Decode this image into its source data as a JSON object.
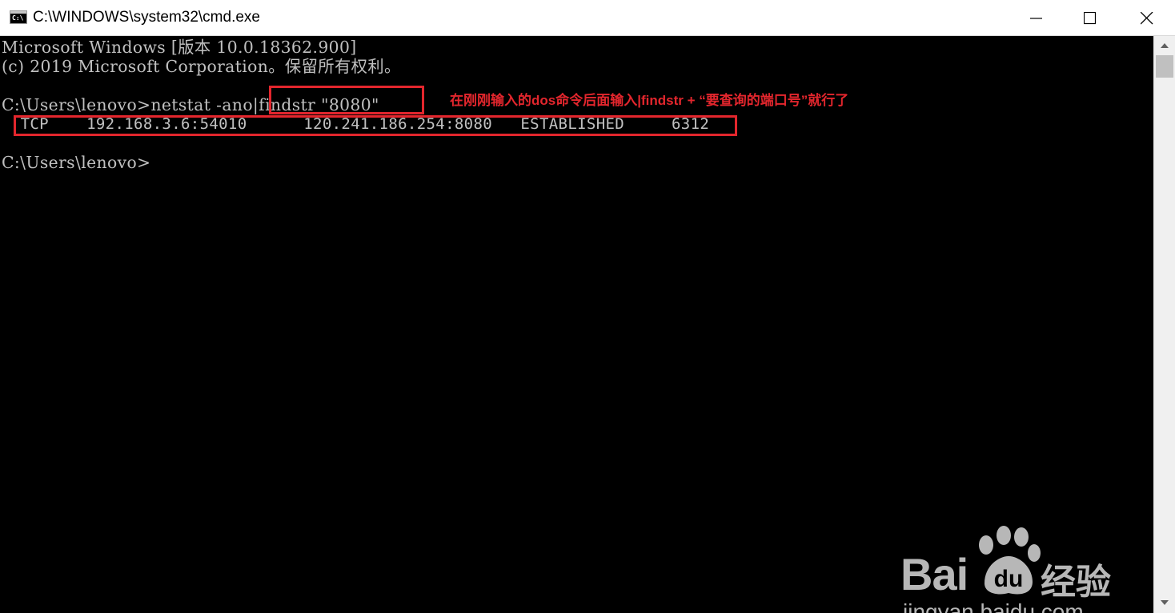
{
  "window": {
    "title": "C:\\WINDOWS\\system32\\cmd.exe",
    "icon_text": "C:\\",
    "controls": [
      "minimize-icon",
      "maximize-icon",
      "close-icon"
    ]
  },
  "console": {
    "lines": [
      "Microsoft Windows [版本 10.0.18362.900]",
      "(c) 2019 Microsoft Corporation。保留所有权利。",
      "C:\\Users\\lenovo>netstat -ano|findstr \"8080\"",
      "  TCP    192.168.3.6:54010      120.241.186.254:8080   ESTABLISHED     6312",
      "C:\\Users\\lenovo>"
    ],
    "text_color": "#c0c0c0",
    "background": "#000000"
  },
  "annotation": {
    "text": "在刚刚输入的dos命令后面输入|findstr + “要查询的端口号”就行了",
    "color": "#e3262d"
  },
  "watermark": {
    "brand_left": "Bai",
    "brand_right": "经验",
    "url": "jingyan.baidu.com"
  }
}
